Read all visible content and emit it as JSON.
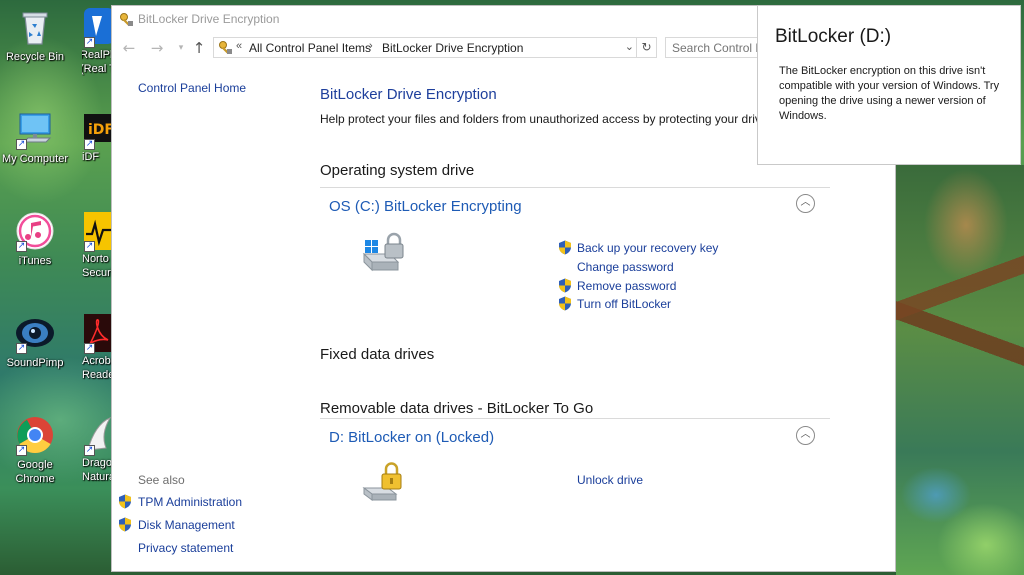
{
  "desktop": {
    "icons": [
      {
        "id": "recycle-bin",
        "label": "Recycle Bin",
        "shortcut": false
      },
      {
        "id": "my-computer",
        "label": "My Computer",
        "shortcut": true
      },
      {
        "id": "itunes",
        "label": "iTunes",
        "shortcut": true
      },
      {
        "id": "soundpimp",
        "label": "SoundPimp",
        "shortcut": true
      },
      {
        "id": "google-chrome",
        "label": "Google Chrome",
        "shortcut": true
      },
      {
        "id": "realplayer",
        "label": "RealPl (Real T",
        "shortcut": true
      },
      {
        "id": "idf",
        "label": "iDF",
        "shortcut": true
      },
      {
        "id": "norton",
        "label": "Norto Securi",
        "shortcut": true
      },
      {
        "id": "acrobat",
        "label": "Acrob Reade",
        "shortcut": true
      },
      {
        "id": "dragon",
        "label": "Drago Natura",
        "shortcut": true
      }
    ]
  },
  "window": {
    "title": "BitLocker Drive Encryption",
    "address": {
      "overflow_glyph": "«",
      "crumbs": [
        "All Control Panel Items",
        "BitLocker Drive Encryption"
      ],
      "separator": "›"
    },
    "search_placeholder": "Search Control Pa",
    "left_pane": {
      "home_link": "Control Panel Home",
      "see_also_heading": "See also",
      "see_also": [
        "TPM Administration",
        "Disk Management",
        "Privacy statement"
      ]
    },
    "main": {
      "heading": "BitLocker Drive Encryption",
      "description": "Help protect your files and folders from unauthorized access by protecting your drives w",
      "sections": {
        "os": {
          "title": "Operating system drive",
          "drive_title": "OS (C:) BitLocker Encrypting",
          "tasks": [
            "Back up your recovery key",
            "Change password",
            "Remove password",
            "Turn off BitLocker"
          ]
        },
        "fixed": {
          "title": "Fixed data drives"
        },
        "removable": {
          "title": "Removable data drives - BitLocker To Go",
          "drive_title": "D: BitLocker on (Locked)",
          "tasks": [
            "Unlock drive"
          ]
        }
      }
    }
  },
  "toast": {
    "title": "BitLocker (D:)",
    "body": "The BitLocker encryption on this drive isn't compatible with your version of Windows. Try opening the drive using a newer version of Windows."
  },
  "colors": {
    "link": "#1a3e9a",
    "drive_title": "#1e5bb5",
    "heading": "#1e3f9c",
    "shield_blue": "#2f5fb8",
    "shield_yellow": "#f2c21b"
  }
}
